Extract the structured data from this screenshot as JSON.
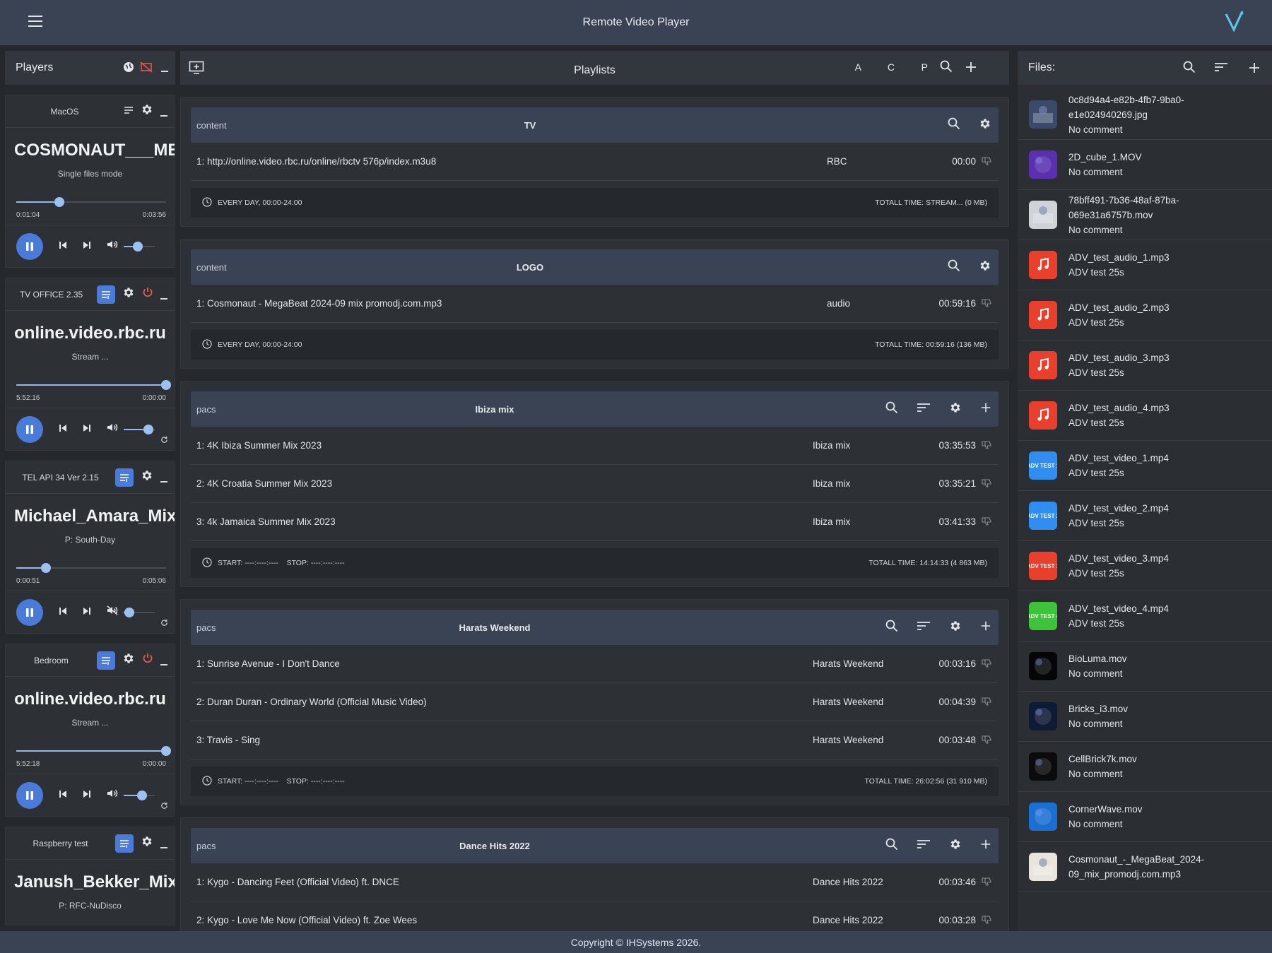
{
  "app": {
    "title": "Remote Video Player",
    "footer": "Copyright © IHSystems 2026."
  },
  "colors": {
    "topbar": "#3a4354",
    "accent": "#4a7bd8",
    "slider": "#9dc0f2",
    "danger": "#e05a4e"
  },
  "players_panel": {
    "title": "Players"
  },
  "players": [
    {
      "name": "MacOS",
      "title": "COSMONAUT___MEGABEAT",
      "subtitle": "Single files mode",
      "elapsed": "0:01:04",
      "total": "0:03:56",
      "progress": 0.29,
      "volume": 0.45,
      "muted": false,
      "power": false,
      "queue_active": false
    },
    {
      "name": "TV OFFICE 2.35",
      "title": "online.video.rbc.ru",
      "subtitle": "Stream ...",
      "elapsed": "5:52:16",
      "total": "0:00:00",
      "progress": 1.0,
      "volume": 0.8,
      "muted": false,
      "power": true,
      "queue_active": true
    },
    {
      "name": "TEL API 34 Ver 2.15",
      "title": "Michael_Amara_Mix",
      "subtitle": "P: South-Day",
      "elapsed": "0:00:51",
      "total": "0:05:06",
      "progress": 0.2,
      "volume": 0.18,
      "muted": true,
      "power": false,
      "queue_active": true
    },
    {
      "name": "Bedroom",
      "title": "online.video.rbc.ru",
      "subtitle": "Stream ...",
      "elapsed": "5:52:18",
      "total": "0:00:00",
      "progress": 1.0,
      "volume": 0.6,
      "muted": false,
      "power": true,
      "queue_active": true
    },
    {
      "name": "Raspberry test",
      "title": "Janush_Bekker_Mix",
      "subtitle": "P: RFC-NuDisco",
      "queue_active": true
    }
  ],
  "playlists_panel": {
    "title": "Playlists",
    "filters": [
      "A",
      "C",
      "P"
    ]
  },
  "playlists": [
    {
      "tag": "content",
      "name": "TV",
      "full_icons": false,
      "items": [
        {
          "title": "1: http://online.video.rbc.ru/online/rbctv 576p/index.m3u8",
          "group": "RBC",
          "duration": "00:00"
        }
      ],
      "schedule": "EVERY DAY, 00:00-24:00",
      "total": "TOTALL TIME: STREAM... (0 MB)"
    },
    {
      "tag": "content",
      "name": "LOGO",
      "full_icons": false,
      "items": [
        {
          "title": "1: Cosmonaut - MegaBeat 2024-09 mix promodj.com.mp3",
          "group": "audio",
          "duration": "00:59:16"
        }
      ],
      "schedule": "EVERY DAY, 00:00-24:00",
      "total": "TOTALL TIME: 00:59:16 (136 MB)"
    },
    {
      "tag": "pacs",
      "name": "Ibiza mix",
      "full_icons": true,
      "items": [
        {
          "title": "1: 4K Ibiza Summer Mix 2023",
          "group": "Ibiza mix",
          "duration": "03:35:53"
        },
        {
          "title": "2: 4K Croatia Summer Mix 2023",
          "group": "Ibiza mix",
          "duration": "03:35:21"
        },
        {
          "title": "3: 4k Jamaica Summer Mix 2023",
          "group": "Ibiza mix",
          "duration": "03:41:33"
        }
      ],
      "schedule": "START: ----:----:----    STOP: ----:----:----",
      "total": "TOTALL TIME: 14:14:33 (4 863 MB)"
    },
    {
      "tag": "pacs",
      "name": "Harats Weekend",
      "full_icons": true,
      "items": [
        {
          "title": "1: Sunrise Avenue - I Don't Dance",
          "group": "Harats Weekend",
          "duration": "00:03:16"
        },
        {
          "title": "2: Duran Duran - Ordinary World (Official Music Video)",
          "group": "Harats Weekend",
          "duration": "00:04:39"
        },
        {
          "title": "3: Travis - Sing",
          "group": "Harats Weekend",
          "duration": "00:03:48"
        }
      ],
      "schedule": "START: ----:----:----    STOP: ----:----:----",
      "total": "TOTALL TIME: 26:02:56 (31 910 MB)"
    },
    {
      "tag": "pacs",
      "name": "Dance Hits 2022",
      "full_icons": true,
      "items": [
        {
          "title": "1: Kygo - Dancing Feet (Official Video) ft. DNCE",
          "group": "Dance Hits 2022",
          "duration": "00:03:46"
        },
        {
          "title": "2: Kygo - Love Me Now (Official Video) ft. Zoe Wees",
          "group": "Dance Hits 2022",
          "duration": "00:03:28"
        }
      ],
      "schedule": "",
      "total": ""
    }
  ],
  "files_panel": {
    "title": "Files:"
  },
  "files": [
    {
      "name": "0c8d94a4-e82b-4fb7-9ba0-e1e024940269.jpg",
      "comment": "No comment",
      "thumb": "photo",
      "color": "#3b4a6b"
    },
    {
      "name": "2D_cube_1.MOV",
      "comment": "No comment",
      "thumb": "video",
      "color": "#5a2fb0"
    },
    {
      "name": "78bff491-7b36-48af-87ba-069e31a6757b.mov",
      "comment": "No comment",
      "thumb": "photo",
      "color": "#cfd3d8"
    },
    {
      "name": "ADV_test_audio_1.mp3",
      "comment": "ADV test 25s",
      "thumb": "audio",
      "color": "#e8402c"
    },
    {
      "name": "ADV_test_audio_2.mp3",
      "comment": "ADV test 25s",
      "thumb": "audio",
      "color": "#e8402c"
    },
    {
      "name": "ADV_test_audio_3.mp3",
      "comment": "ADV test 25s",
      "thumb": "audio",
      "color": "#e8402c"
    },
    {
      "name": "ADV_test_audio_4.mp3",
      "comment": "ADV test 25s",
      "thumb": "audio",
      "color": "#e8402c"
    },
    {
      "name": "ADV_test_video_1.mp4",
      "comment": "ADV test 25s",
      "thumb": "adv",
      "color": "#2f8ef0",
      "badge": "ADV TEST 1"
    },
    {
      "name": "ADV_test_video_2.mp4",
      "comment": "ADV test 25s",
      "thumb": "adv",
      "color": "#2f8ef0",
      "badge": "ADV TEST 2"
    },
    {
      "name": "ADV_test_video_3.mp4",
      "comment": "ADV test 25s",
      "thumb": "adv",
      "color": "#e8402c",
      "badge": "ADV TEST 3"
    },
    {
      "name": "ADV_test_video_4.mp4",
      "comment": "ADV test 25s",
      "thumb": "adv",
      "color": "#3ec43a",
      "badge": "ADV TEST 4"
    },
    {
      "name": "BioLuma.mov",
      "comment": "No comment",
      "thumb": "video",
      "color": "#050607"
    },
    {
      "name": "Bricks_i3.mov",
      "comment": "No comment",
      "thumb": "video",
      "color": "#0f1a36"
    },
    {
      "name": "CellBrick7k.mov",
      "comment": "No comment",
      "thumb": "video",
      "color": "#0b0b0b"
    },
    {
      "name": "CornerWave.mov",
      "comment": "No comment",
      "thumb": "video",
      "color": "#1b6fd1"
    },
    {
      "name": "Cosmonaut_-_MegaBeat_2024-09_mix_promodj.com.mp3",
      "comment": "",
      "thumb": "photo",
      "color": "#e9e4dc"
    }
  ]
}
